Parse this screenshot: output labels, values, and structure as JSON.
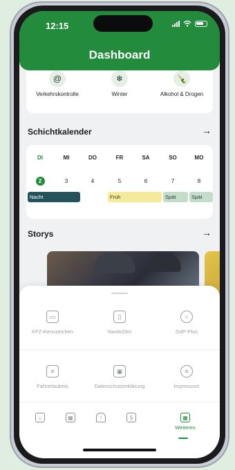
{
  "status": {
    "time": "12:15"
  },
  "header": {
    "title": "Dashboard"
  },
  "categories": [
    {
      "label": "Verkehrskontrolle",
      "icon": "@"
    },
    {
      "label": "Winter",
      "icon": "❄"
    },
    {
      "label": "Alkohol & Drogen",
      "icon": "🍾"
    }
  ],
  "schichtkalender": {
    "title": "Schichtkalender",
    "arrow": "→",
    "days": [
      {
        "day": "DI",
        "num": "2"
      },
      {
        "day": "MI",
        "num": "3"
      },
      {
        "day": "DO",
        "num": "4"
      },
      {
        "day": "FR",
        "num": "5"
      },
      {
        "day": "SA",
        "num": "6"
      },
      {
        "day": "SO",
        "num": "7"
      },
      {
        "day": "MO",
        "num": "8"
      }
    ],
    "shifts": {
      "nacht": "Nacht",
      "frueh": "Früh",
      "spaet1": "Spät",
      "spaet2": "Spät"
    }
  },
  "storys": {
    "title": "Storys",
    "arrow": "→"
  },
  "sheet": {
    "row1": [
      {
        "label": "KFZ-Kennzeichen",
        "icon": "car-icon"
      },
      {
        "label": "NauticDict",
        "icon": "book-icon"
      },
      {
        "label": "GdP-Plus",
        "icon": "badge-icon"
      }
    ],
    "row2": [
      {
        "label": "Fahrerlaubnis",
        "icon": "id-card-icon"
      },
      {
        "label": "Datenschutzerklärung",
        "icon": "folder-lock-icon"
      },
      {
        "label": "Impressum",
        "icon": "document-icon"
      }
    ]
  },
  "tabs": [
    {
      "name": "home",
      "icon": "house-icon"
    },
    {
      "name": "calendar",
      "icon": "calendar-icon"
    },
    {
      "name": "alert",
      "icon": "siren-icon"
    },
    {
      "name": "law",
      "icon": "paragraph-icon"
    },
    {
      "name": "more",
      "icon": "grid-icon",
      "label": "Weiteres"
    }
  ],
  "colors": {
    "brand": "#228b3c",
    "nacht": "#24535e",
    "frueh": "#f7e99a",
    "spaet": "#c4ddcb"
  }
}
